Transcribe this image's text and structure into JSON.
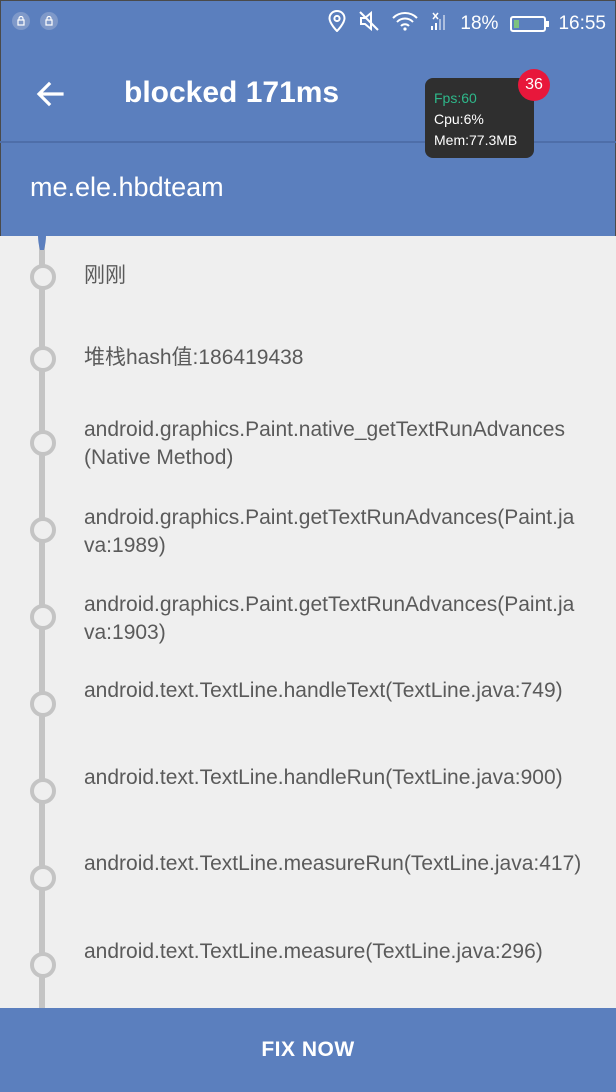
{
  "status_bar": {
    "battery_percent": "18%",
    "battery_level": 0.18,
    "time": "16:55",
    "icons": [
      "app-notification-icon",
      "app-notification-icon",
      "location-icon",
      "mute-icon",
      "wifi-icon",
      "signal-off-icon",
      "battery-icon"
    ]
  },
  "toolbar": {
    "back_icon": "back-arrow-icon",
    "title": "blocked 171ms",
    "subtitle": "me.ele.hbdteam"
  },
  "perf_overlay": {
    "fps": "Fps:60",
    "cpu": "Cpu:6%",
    "mem": "Mem:77.3MB",
    "badge": "36"
  },
  "timeline": [
    {
      "text": "刚刚"
    },
    {
      "text": "堆栈hash值:186419438"
    },
    {
      "text": "android.graphics.Paint.native_getTextRunAdvances(Native Method)"
    },
    {
      "text": "android.graphics.Paint.getTextRunAdvances(Paint.java:1989)"
    },
    {
      "text": "android.graphics.Paint.getTextRunAdvances(Paint.java:1903)"
    },
    {
      "text": "android.text.TextLine.handleText(TextLine.java:749)"
    },
    {
      "text": "android.text.TextLine.handleRun(TextLine.java:900)"
    },
    {
      "text": "android.text.TextLine.measureRun(TextLine.java:417)"
    },
    {
      "text": "android.text.TextLine.measure(TextLine.java:296)"
    }
  ],
  "action_button": {
    "label": "FIX NOW"
  },
  "colors": {
    "primary": "#5b7fbe",
    "content_bg": "#efefef",
    "timeline": "#c4c4c4",
    "fps_green": "#2eb88a",
    "badge_red": "#e8173b"
  }
}
